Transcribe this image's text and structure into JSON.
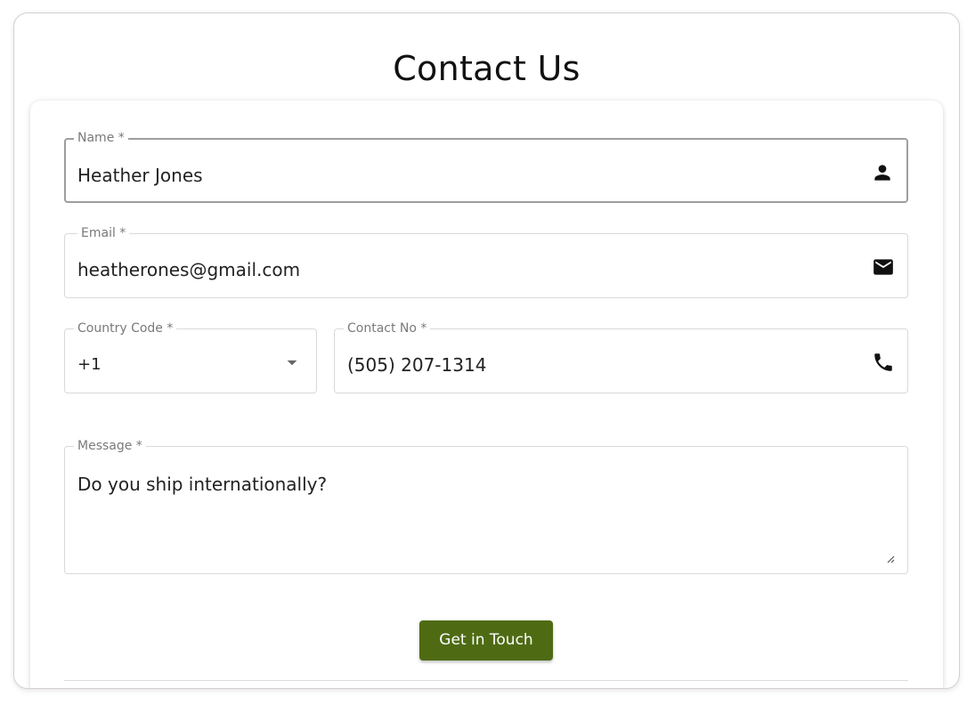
{
  "page": {
    "title": "Contact Us"
  },
  "form": {
    "name": {
      "label": "Name *",
      "value": "Heather Jones",
      "icon": "person-icon"
    },
    "email": {
      "label": "Email *",
      "value": "heatherones@gmail.com",
      "icon": "mail-icon"
    },
    "country_code": {
      "label": "Country Code *",
      "value": "+1",
      "icon": "dropdown-arrow-icon"
    },
    "contact_no": {
      "label": "Contact No *",
      "value": "(505) 207-1314",
      "icon": "phone-icon"
    },
    "message": {
      "label": "Message *",
      "value": "Do you ship internationally?"
    },
    "submit_label": "Get in Touch"
  },
  "colors": {
    "accent": "#4e6b14",
    "border": "#d9d9d9",
    "focused_border": "#9e9e9e",
    "label_text": "#7a7a7a"
  }
}
